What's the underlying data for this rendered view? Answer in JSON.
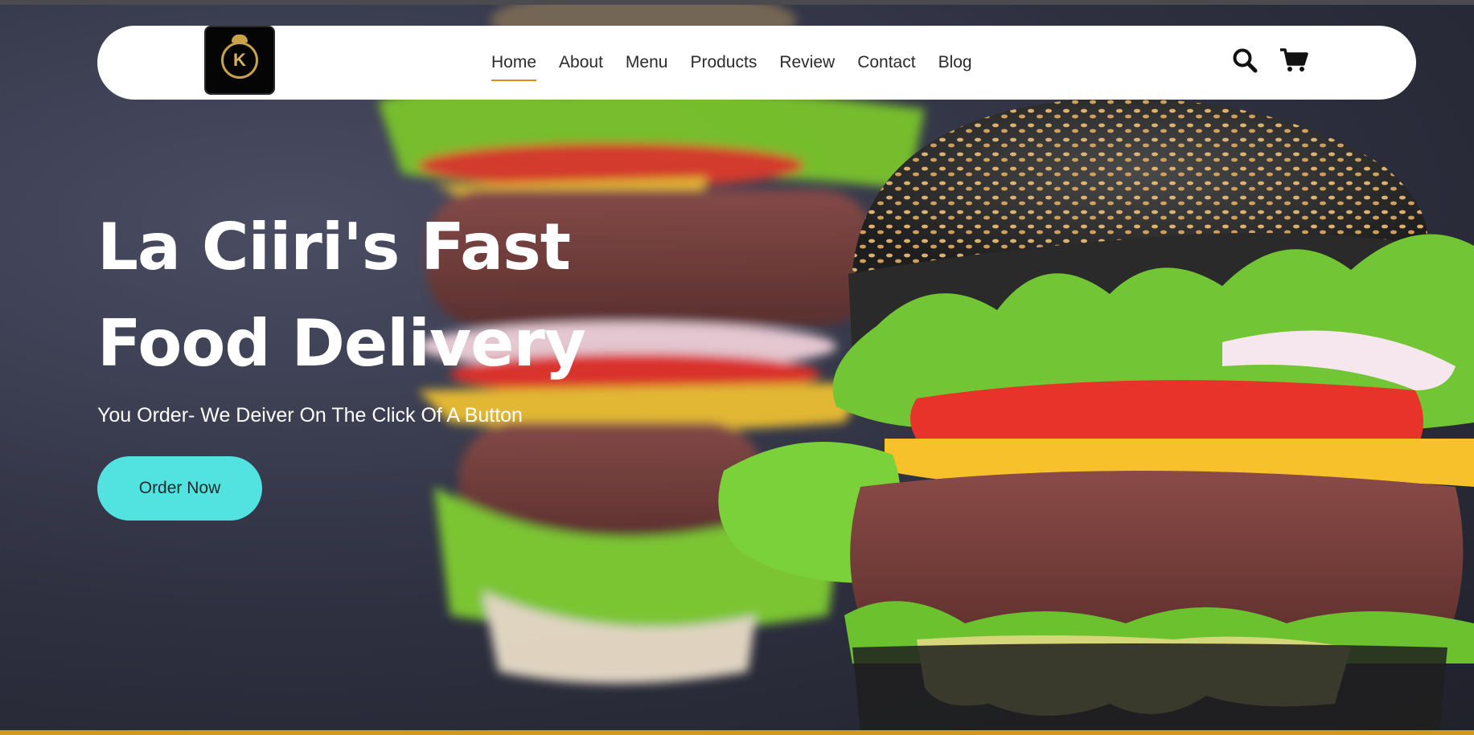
{
  "brand": {
    "logo_letter": "K"
  },
  "nav": {
    "items": [
      {
        "label": "Home",
        "active": true
      },
      {
        "label": "About",
        "active": false
      },
      {
        "label": "Menu",
        "active": false
      },
      {
        "label": "Products",
        "active": false
      },
      {
        "label": "Review",
        "active": false
      },
      {
        "label": "Contact",
        "active": false
      },
      {
        "label": "Blog",
        "active": false
      }
    ],
    "search_icon": "search-icon",
    "cart_icon": "cart-icon"
  },
  "hero": {
    "title_line1": "La Ciiri's Fast",
    "title_line2": "Food Delivery",
    "subtitle": "You Order- We Deiver On The Click Of A Button",
    "cta_label": "Order Now"
  },
  "colors": {
    "accent_underline": "#e08a1e",
    "cta_background": "#52e3e1",
    "bottom_strip": "#d4961f"
  }
}
